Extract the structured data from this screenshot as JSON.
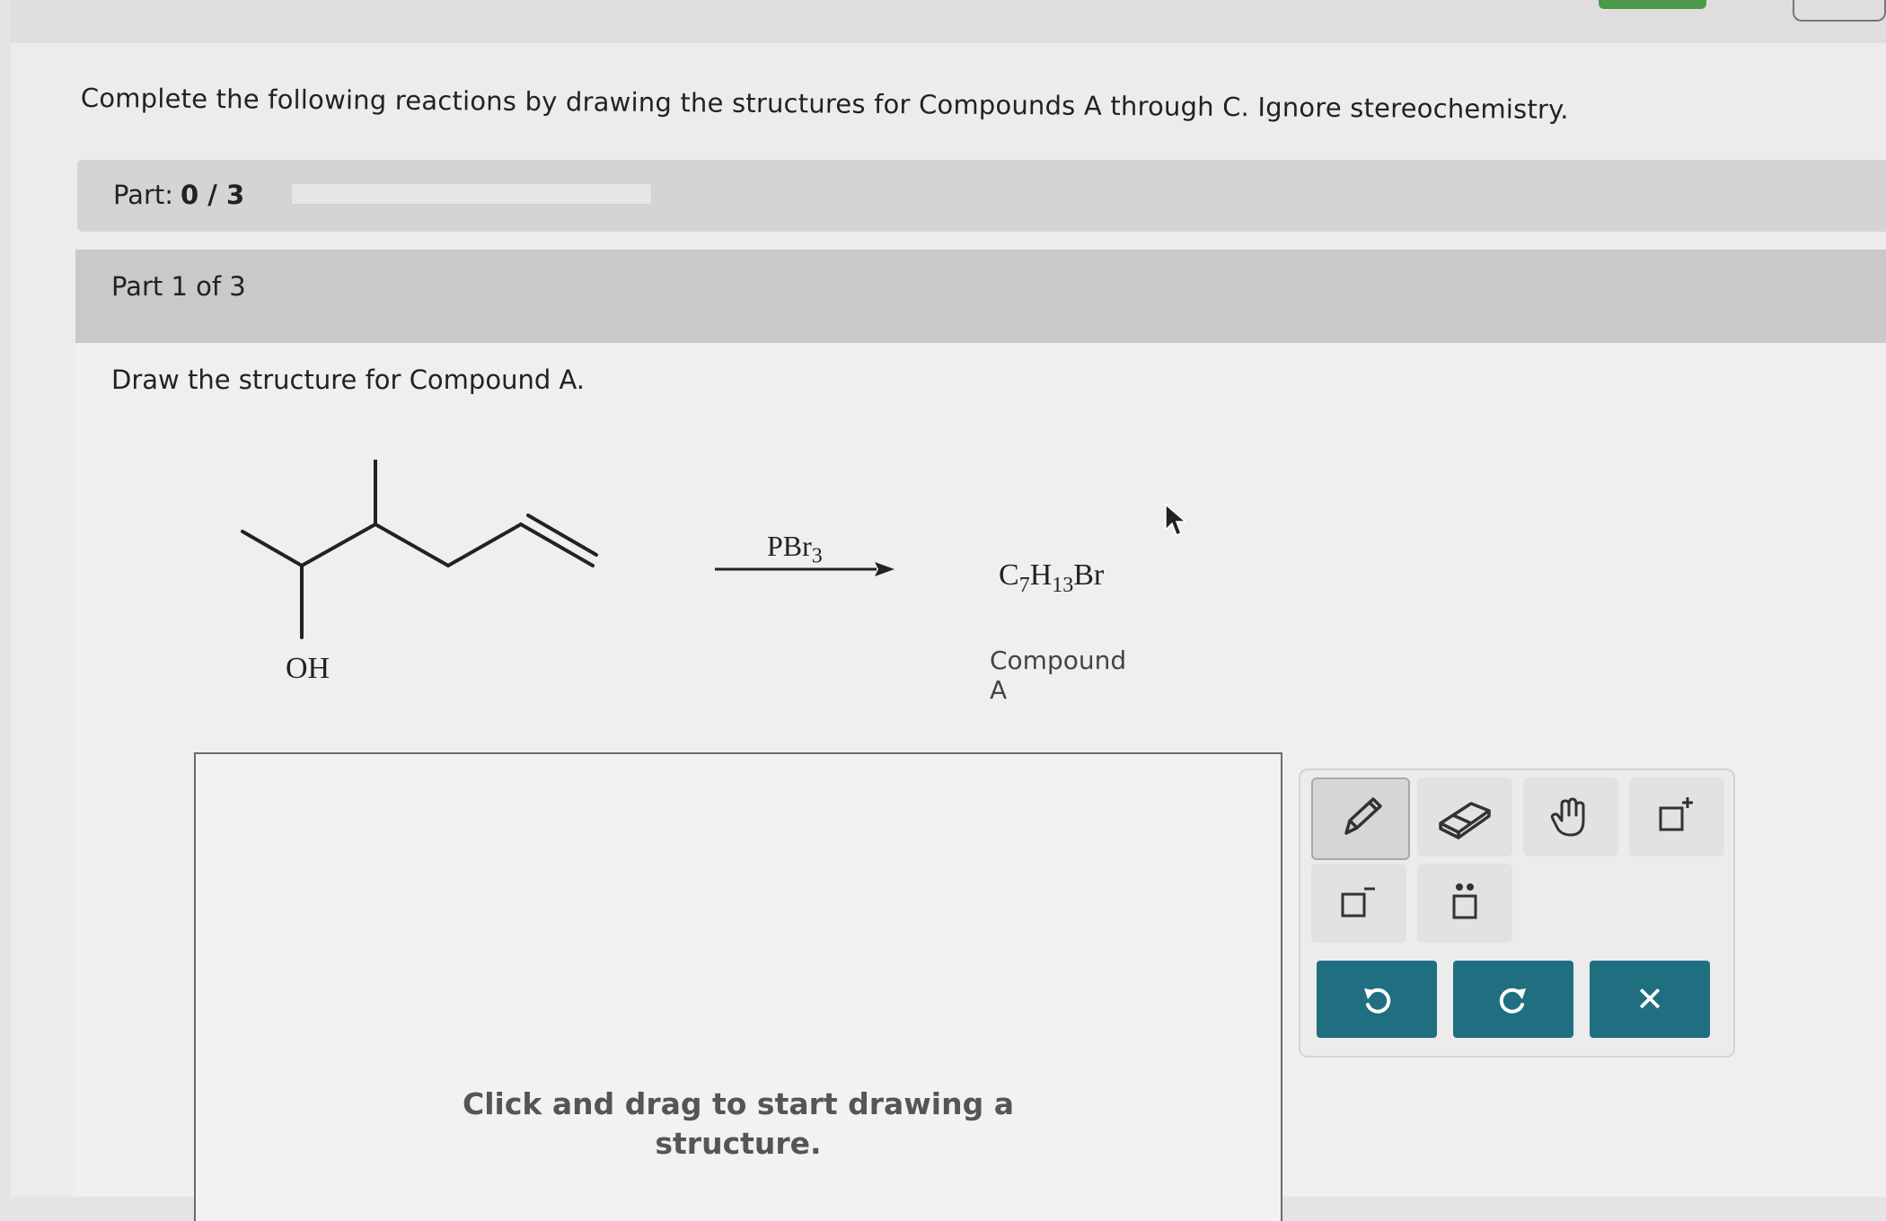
{
  "instructions": "Complete the following reactions by drawing the structures for Compounds A through C. Ignore stereochemistry.",
  "progress": {
    "label": "Part:",
    "value": "0 / 3",
    "fraction": 0
  },
  "part": {
    "header": "Part 1 of 3",
    "prompt": "Draw the structure for Compound A."
  },
  "reaction": {
    "substituent_label": "OH",
    "reagent": {
      "main": "PBr",
      "sub": "3"
    },
    "product": {
      "c": "C",
      "c_sub": "7",
      "h": "H",
      "h_sub": "13",
      "br": "Br",
      "label": "Compound A"
    }
  },
  "canvas": {
    "hint_line1": "Click and drag to start drawing a",
    "hint_line2": "structure."
  },
  "toolbar": {
    "tools": [
      "pencil-icon",
      "eraser-icon",
      "hand-icon",
      "positive-charge-icon",
      "negative-charge-icon",
      "lone-pair-icon"
    ],
    "actions": {
      "undo_icon": "undo-icon",
      "redo_icon": "redo-icon",
      "clear_glyph": "✕"
    }
  },
  "colors": {
    "action_button": "#1f6f80",
    "part_header": "#c9c9c9",
    "part_bar": "#d4d4d4"
  }
}
